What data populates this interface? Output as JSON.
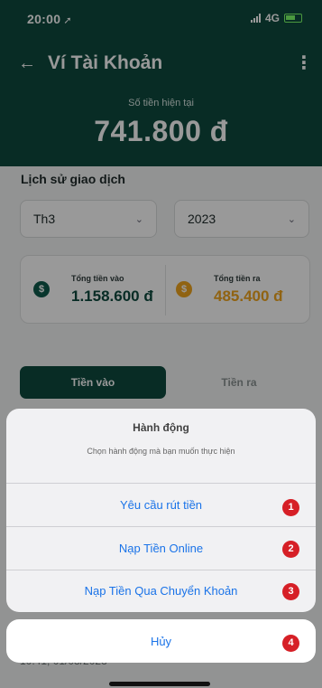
{
  "status_bar": {
    "time": "20:00",
    "network": "4G"
  },
  "header": {
    "title": "Ví Tài Khoản",
    "balance_label": "Số tiền hiện tại",
    "balance_value": "741.800 đ"
  },
  "history": {
    "title": "Lịch sử giao dịch",
    "month_select": "Th3",
    "year_select": "2023"
  },
  "summary": {
    "in_label": "Tổng tiền vào",
    "in_value": "1.158.600 đ",
    "out_label": "Tổng tiền ra",
    "out_value": "485.400 đ"
  },
  "tabs": {
    "in": "Tiền vào",
    "out": "Tiền ra"
  },
  "transaction": {
    "time": "10:41, 01/03/2023"
  },
  "action_sheet": {
    "title": "Hành động",
    "message": "Chọn hành động mà bạn muốn thực hiện",
    "options": [
      {
        "label": "Yêu cầu rút tiền",
        "badge": "1"
      },
      {
        "label": "Nạp Tiền Online",
        "badge": "2"
      },
      {
        "label": "Nạp Tiền Qua Chuyển Khoản",
        "badge": "3"
      }
    ],
    "cancel": {
      "label": "Hủy",
      "badge": "4"
    }
  },
  "colors": {
    "header_bg": "#0e4a3f",
    "money_in": "#0e4a3f",
    "money_out": "#f0a51e",
    "action_text": "#1a73e8",
    "badge": "#d61f26"
  },
  "icons": [
    "back-arrow-icon",
    "more-vert-icon",
    "chevron-down-icon",
    "coin-icon",
    "signal-icon",
    "battery-icon"
  ]
}
